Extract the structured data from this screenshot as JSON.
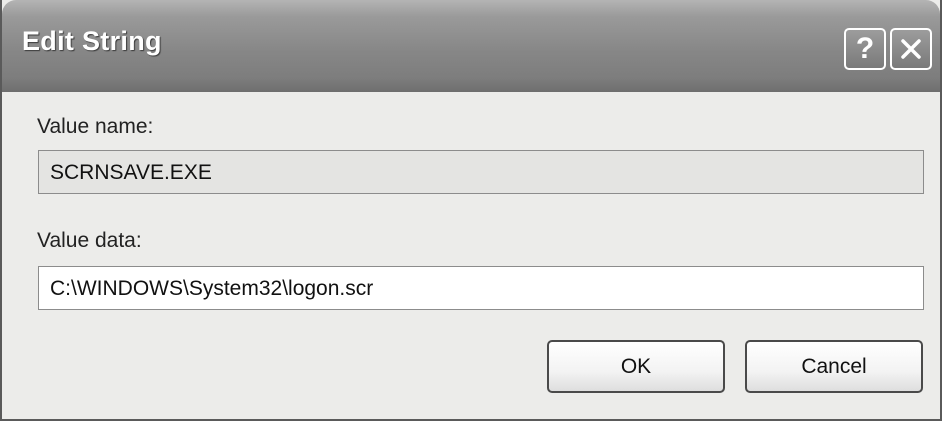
{
  "window": {
    "title": "Edit String",
    "help_glyph": "?",
    "help_icon": "question-mark-icon",
    "close_icon": "close-x-icon"
  },
  "value_name": {
    "label": "Value name:",
    "value": "SCRNSAVE.EXE"
  },
  "value_data": {
    "label": "Value data:",
    "value": "C:\\WINDOWS\\System32\\logon.scr"
  },
  "buttons": {
    "ok": "OK",
    "cancel": "Cancel"
  }
}
